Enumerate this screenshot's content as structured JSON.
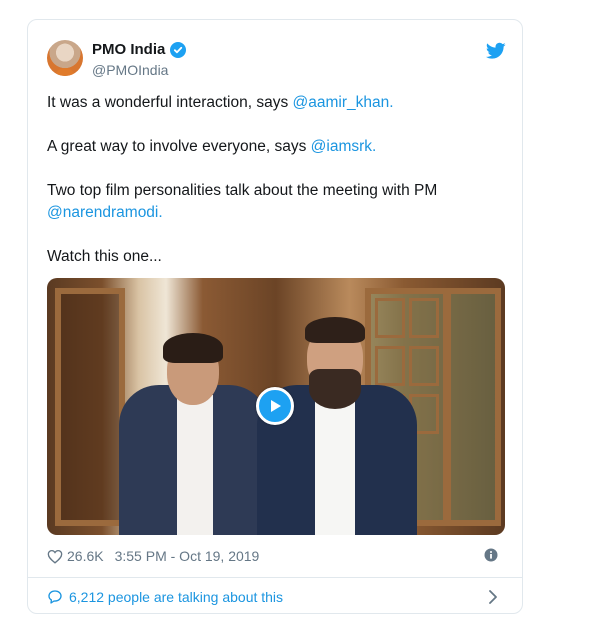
{
  "tweet": {
    "display_name": "PMO India",
    "handle": "@PMOIndia",
    "paragraphs": {
      "p1_text": "It was a wonderful interaction, says ",
      "p1_mention": "@aamir_khan",
      "p1_end": ".",
      "p2_text": "A great way to involve everyone, says ",
      "p2_mention": "@iamsrk",
      "p2_end": ".",
      "p3_text": "Two top film personalities talk about the meeting with PM ",
      "p3_mention": "@narendramodi",
      "p3_end": ".",
      "p4_text": "Watch this one..."
    },
    "likes": "26.6K",
    "timestamp": "3:55 PM - Oct 19, 2019",
    "conversation_text": "6,212 people are talking about this"
  },
  "colors": {
    "brand_blue": "#1da1f2",
    "link_blue": "#1b95e0",
    "muted_text": "#657786"
  },
  "icons": [
    "verified-badge-icon",
    "twitter-bird-icon",
    "play-icon",
    "heart-icon",
    "info-icon",
    "speech-bubble-icon",
    "chevron-right-icon"
  ]
}
